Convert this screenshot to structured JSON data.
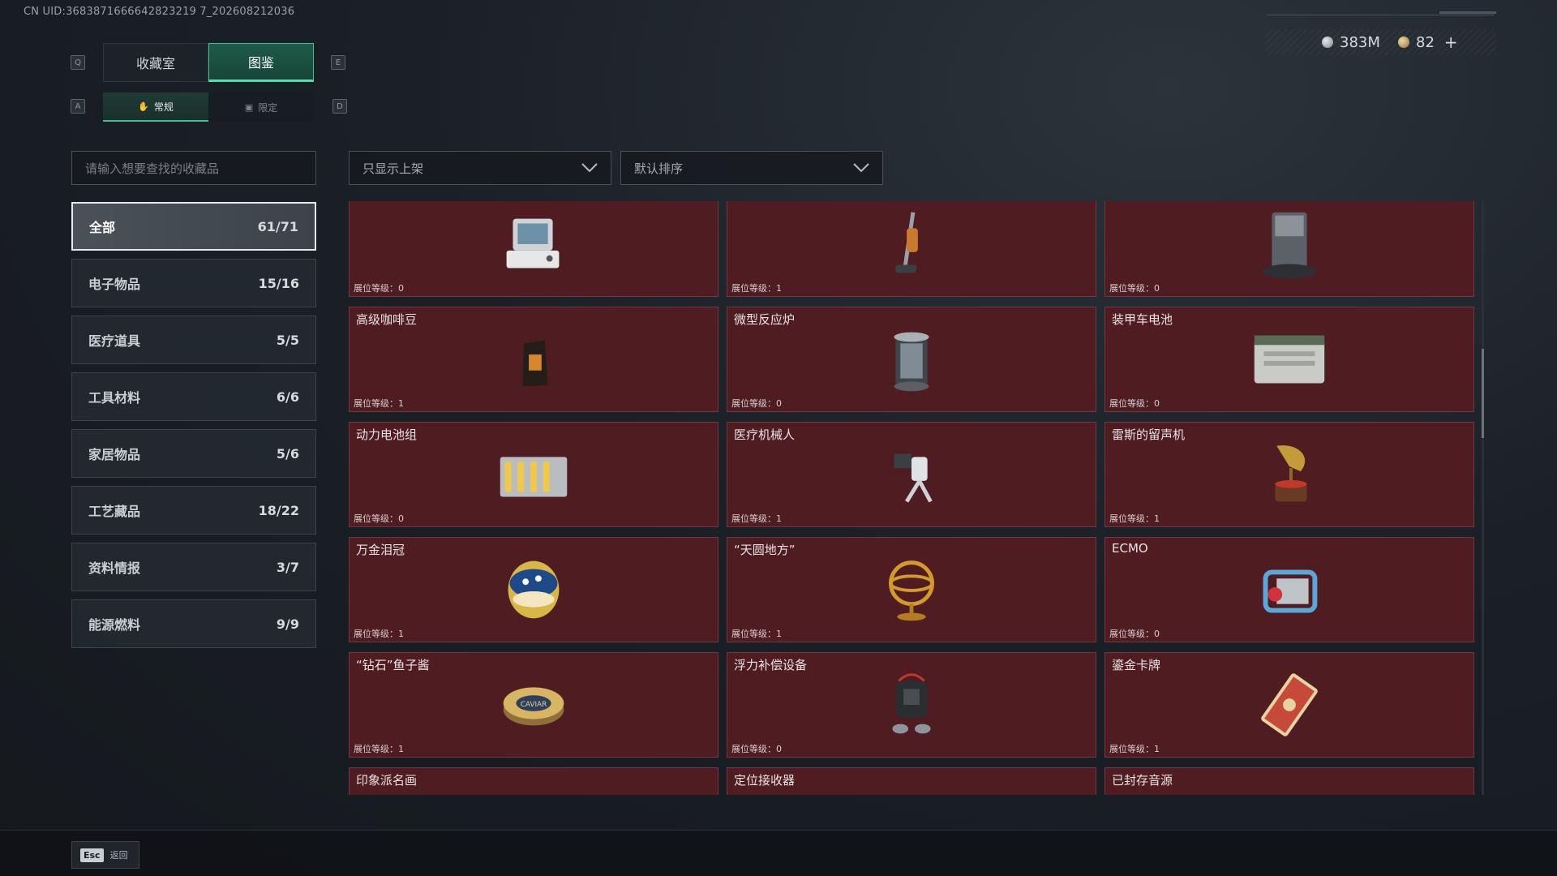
{
  "header": {
    "uid": "CN UID:3683871666642823219 7_202608212036",
    "currency_silver": "383M",
    "currency_gold": "82",
    "plus": "+"
  },
  "keyhints": {
    "q": "Q",
    "e": "E",
    "a": "A",
    "d": "D"
  },
  "tabs": [
    {
      "label": "收藏室",
      "active": false
    },
    {
      "label": "图鉴",
      "active": true
    }
  ],
  "subtabs": [
    {
      "label": "常规",
      "icon": "hand-icon",
      "active": true
    },
    {
      "label": "限定",
      "icon": "image-icon",
      "active": false
    }
  ],
  "search": {
    "placeholder": "请输入想要查找的收藏品"
  },
  "filters": {
    "shelf": "只显示上架",
    "sort": "默认排序"
  },
  "categories": [
    {
      "label": "全部",
      "count": "61/71",
      "active": true
    },
    {
      "label": "电子物品",
      "count": "15/16"
    },
    {
      "label": "医疗道具",
      "count": "5/5"
    },
    {
      "label": "工具材料",
      "count": "6/6"
    },
    {
      "label": "家居物品",
      "count": "5/6"
    },
    {
      "label": "工艺藏品",
      "count": "18/22"
    },
    {
      "label": "资料情报",
      "count": "3/7"
    },
    {
      "label": "能源燃料",
      "count": "9/9"
    }
  ],
  "level_label": "展位等级：",
  "items": [
    {
      "name": "",
      "level": "0",
      "icon": "computer-terminal-icon"
    },
    {
      "name": "",
      "level": "1",
      "icon": "vacuum-cleaner-icon"
    },
    {
      "name": "",
      "level": "0",
      "icon": "robot-vacuum-dock-icon"
    },
    {
      "name": "高级咖啡豆",
      "level": "1",
      "icon": "coffee-bag-icon"
    },
    {
      "name": "微型反应炉",
      "level": "0",
      "icon": "reactor-icon"
    },
    {
      "name": "装甲车电池",
      "level": "0",
      "icon": "vehicle-battery-icon"
    },
    {
      "name": "动力电池组",
      "level": "0",
      "icon": "battery-pack-icon"
    },
    {
      "name": "医疗机械人",
      "level": "1",
      "icon": "medical-robot-icon"
    },
    {
      "name": "雷斯的留声机",
      "level": "1",
      "icon": "gramophone-icon"
    },
    {
      "name": "万金泪冠",
      "level": "1",
      "icon": "jeweled-egg-icon"
    },
    {
      "name": "“天圆地方”",
      "level": "1",
      "icon": "armillary-sphere-icon"
    },
    {
      "name": "ECMO",
      "level": "0",
      "icon": "ecmo-machine-icon"
    },
    {
      "name": "“钻石”鱼子酱",
      "level": "1",
      "icon": "caviar-tin-icon"
    },
    {
      "name": "浮力补偿设备",
      "level": "0",
      "icon": "buoyancy-device-icon"
    },
    {
      "name": "鎏金卡牌",
      "level": "1",
      "icon": "gilded-card-icon"
    },
    {
      "name": "印象派名画",
      "level": "",
      "icon": "framed-painting-icon"
    },
    {
      "name": "定位接收器",
      "level": "",
      "icon": "locator-receiver-icon"
    },
    {
      "name": "已封存音源",
      "level": "",
      "icon": "sealed-audio-icon"
    }
  ],
  "footer": {
    "esc_key": "Esc",
    "esc_label": "返回"
  },
  "colors": {
    "accent": "#3fbf93",
    "card_bg": "#4f1c22"
  }
}
